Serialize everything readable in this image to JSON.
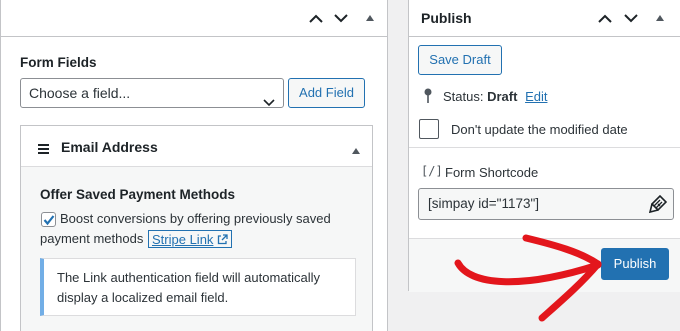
{
  "left_panel": {
    "form_fields_label": "Form Fields",
    "field_select": {
      "value": "Choose a field..."
    },
    "add_field_label": "Add Field",
    "email_section": {
      "title": "Email Address",
      "option_title": "Offer Saved Payment Methods",
      "checkbox_checked": true,
      "boost_line1": "Boost conversions by offering previously saved",
      "boost_line2": "payment methods",
      "stripe_link_label": "Stripe Link",
      "notice_line1": "The Link authentication field will automatically",
      "notice_line2": "display a localized email field."
    }
  },
  "publish_panel": {
    "title": "Publish",
    "save_draft_label": "Save Draft",
    "status_label": "Status:",
    "status_value": "Draft",
    "edit_label": "Edit",
    "dont_update_label": "Don't update the modified date",
    "shortcode_icon_text": "[/]",
    "shortcode_label": "Form Shortcode",
    "shortcode_value": "[simpay id=\"1173\"]",
    "publish_label": "Publish"
  },
  "colors": {
    "accent": "#2271b1",
    "annotation_arrow": "#e3161c",
    "notice_border": "#72aee6"
  }
}
